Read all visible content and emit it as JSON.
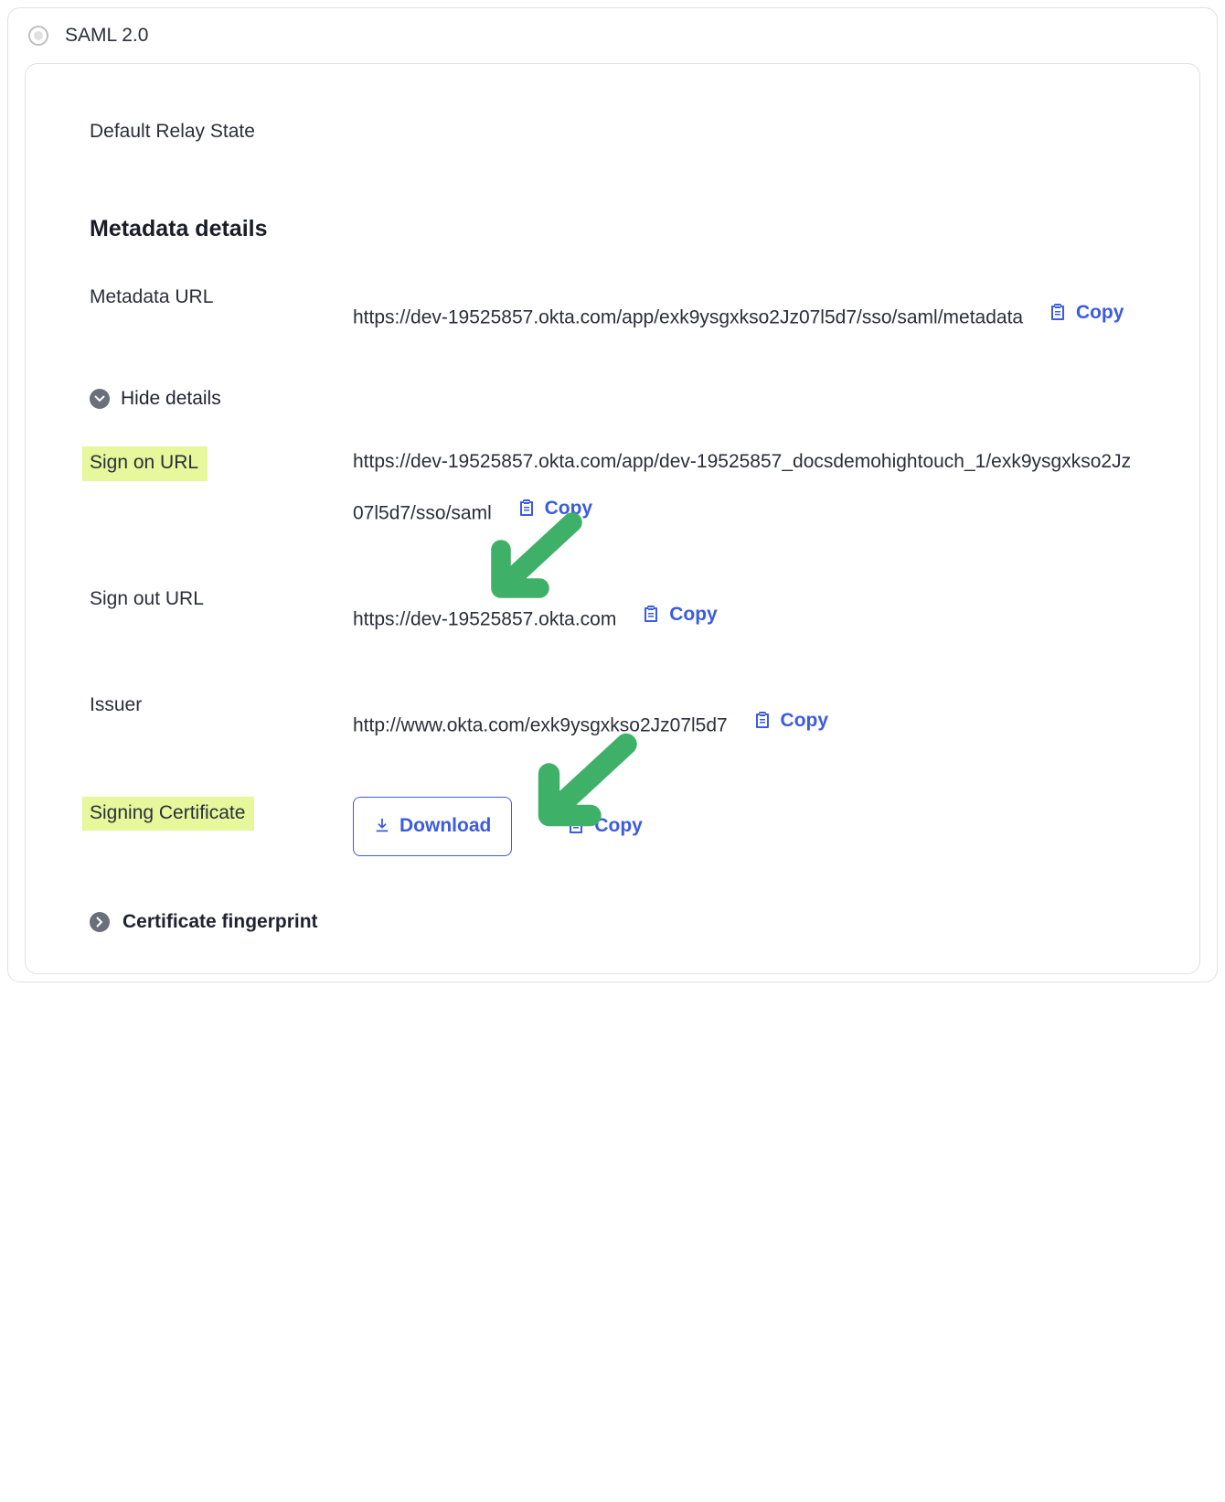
{
  "radio_label": "SAML 2.0",
  "default_relay_state_label": "Default Relay State",
  "section_title": "Metadata details",
  "metadata_url": {
    "label": "Metadata URL",
    "value": "https://dev-19525857.okta.com/app/exk9ysgxkso2Jz07l5d7/sso/saml/metadata",
    "copy_label": "Copy"
  },
  "hide_details_label": "Hide details",
  "sign_on_url": {
    "label": "Sign on URL",
    "value": "https://dev-19525857.okta.com/app/dev-19525857_docsdemohightouch_1/exk9ysgxkso2Jz07l5d7/sso/saml",
    "copy_label": "Copy"
  },
  "sign_out_url": {
    "label": "Sign out URL",
    "value": "https://dev-19525857.okta.com",
    "copy_label": "Copy"
  },
  "issuer": {
    "label": "Issuer",
    "value": "http://www.okta.com/exk9ysgxkso2Jz07l5d7",
    "copy_label": "Copy"
  },
  "signing_certificate": {
    "label": "Signing Certificate",
    "download_label": "Download",
    "copy_label": "Copy"
  },
  "certificate_fingerprint_label": "Certificate fingerprint"
}
